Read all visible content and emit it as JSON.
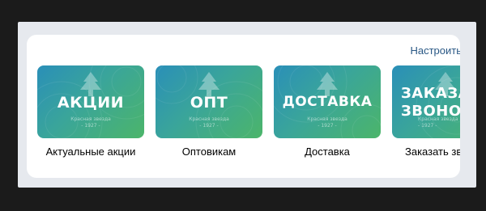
{
  "header": {
    "configure_label": "Настроить"
  },
  "brand": {
    "name": "Красная звезда",
    "year": "- 1927 -"
  },
  "tiles": [
    {
      "title": "АКЦИИ",
      "label": "Актуальные акции"
    },
    {
      "title": "ОПТ",
      "label": "Оптовикам"
    },
    {
      "title": "ДОСТАВКА",
      "label": "Доставка"
    },
    {
      "title": "ЗАКАЗА\nЗВОНО",
      "label": "Заказать зв"
    }
  ],
  "colors": {
    "accent": "#2a5885",
    "tile_gradient": [
      "#2a8fb8",
      "#4cb56a"
    ]
  },
  "icons": {
    "tile_emblem": "fir-tree-icon"
  }
}
